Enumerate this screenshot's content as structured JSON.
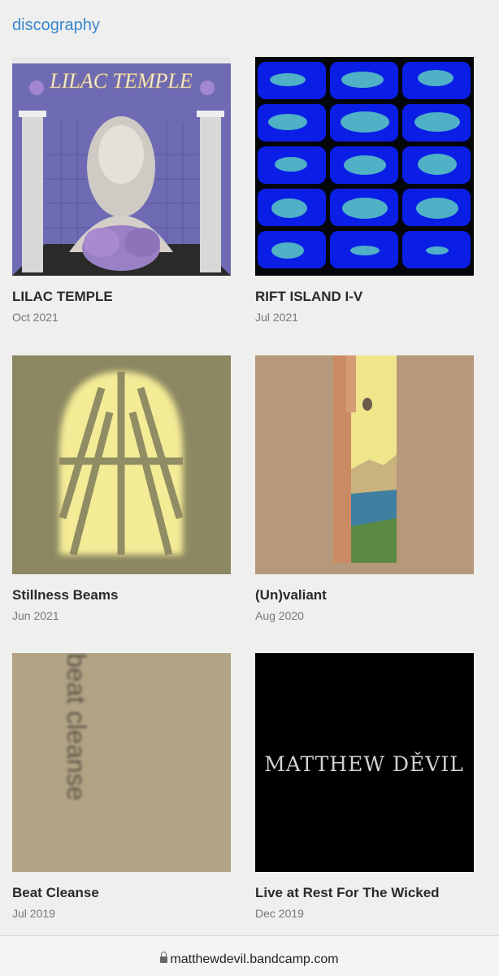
{
  "section": {
    "title": "discography"
  },
  "albums": [
    {
      "title": "LILAC TEMPLE",
      "date": "Oct 2021",
      "cover_text": "LILAC TEMPLE"
    },
    {
      "title": "RIFT ISLAND I-V",
      "date": "Jul 2021"
    },
    {
      "title": "Stillness Beams",
      "date": "Jun 2021"
    },
    {
      "title": "(Un)valiant",
      "date": "Aug 2020"
    },
    {
      "title": "Beat Cleanse",
      "date": "Jul 2019",
      "cover_text": "beat cleanse"
    },
    {
      "title": "Live at Rest For The Wicked",
      "date": "Dec 2019",
      "cover_text": "MATTHEW DĚVIL"
    }
  ],
  "urlbar": {
    "url": "matthewdevil.bandcamp.com"
  },
  "colors": {
    "accent": "#3a86d0",
    "text": "#2a2a2a",
    "muted": "#777777"
  }
}
